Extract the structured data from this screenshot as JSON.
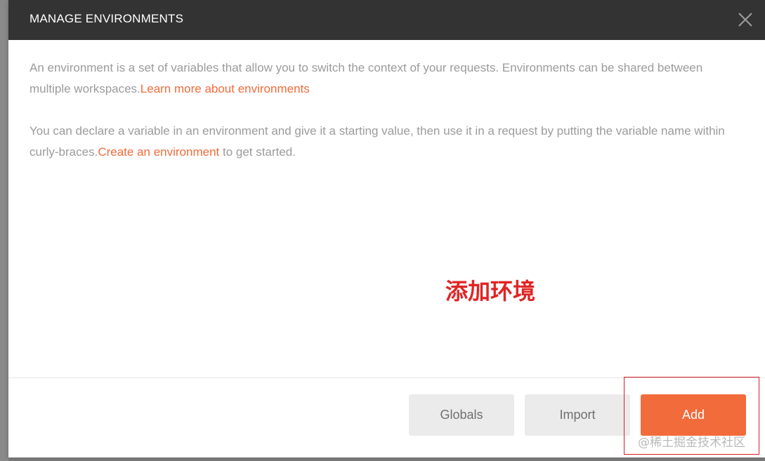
{
  "modal": {
    "title": "MANAGE ENVIRONMENTS",
    "close_icon": "close-icon",
    "para1": {
      "text": "An environment is a set of variables that allow you to switch the context of your requests. Environments can be shared between multiple workspaces.",
      "link": "Learn more about environments"
    },
    "para2": {
      "text": "You can declare a variable in an environment and give it a starting value, then use it in a request by putting the variable name within curly-braces.",
      "link": "Create an environment",
      "suffix": " to get started."
    }
  },
  "annotation": "添加环境",
  "footer": {
    "globals_label": "Globals",
    "import_label": "Import",
    "add_label": "Add"
  },
  "watermark": "@稀土掘金技术社区",
  "colors": {
    "accent": "#f26b3a",
    "header_bg": "#333333",
    "annotation": "#e02424"
  }
}
